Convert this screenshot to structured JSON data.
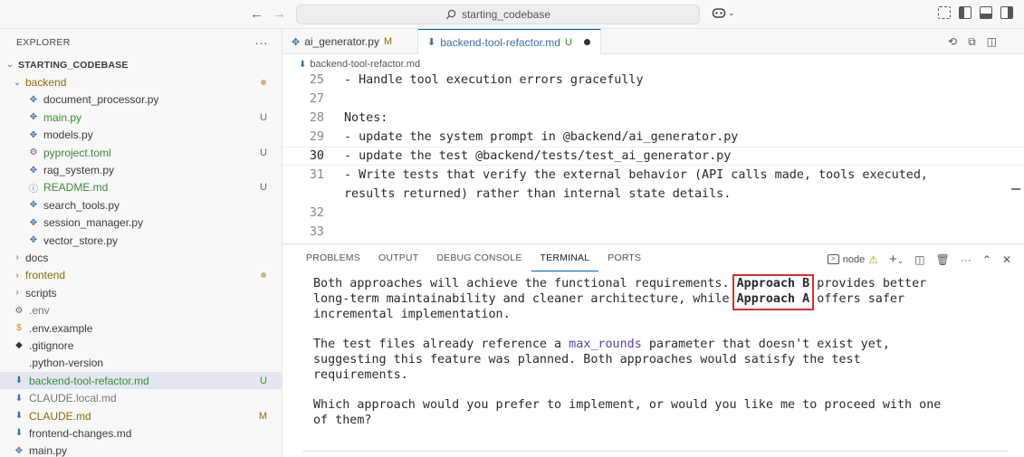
{
  "titlebar": {
    "search_text": "starting_codebase"
  },
  "sidebar": {
    "header": "EXPLORER",
    "root": "STARTING_CODEBASE",
    "items": [
      {
        "label": "backend",
        "kind": "folder-open",
        "depth": 1,
        "badge": "",
        "color": "c-mod",
        "dot": true
      },
      {
        "label": "document_processor.py",
        "kind": "py",
        "depth": 2,
        "badge": "",
        "color": ""
      },
      {
        "label": "main.py",
        "kind": "py",
        "depth": 2,
        "badge": "U",
        "color": "c-green"
      },
      {
        "label": "models.py",
        "kind": "py",
        "depth": 2,
        "badge": "",
        "color": ""
      },
      {
        "label": "pyproject.toml",
        "kind": "gear",
        "depth": 2,
        "badge": "U",
        "color": "c-green"
      },
      {
        "label": "rag_system.py",
        "kind": "py",
        "depth": 2,
        "badge": "",
        "color": ""
      },
      {
        "label": "README.md",
        "kind": "info",
        "depth": 2,
        "badge": "U",
        "color": "c-green"
      },
      {
        "label": "search_tools.py",
        "kind": "py",
        "depth": 2,
        "badge": "",
        "color": ""
      },
      {
        "label": "session_manager.py",
        "kind": "py",
        "depth": 2,
        "badge": "",
        "color": ""
      },
      {
        "label": "vector_store.py",
        "kind": "py",
        "depth": 2,
        "badge": "",
        "color": ""
      },
      {
        "label": "docs",
        "kind": "folder",
        "depth": 1,
        "badge": "",
        "color": ""
      },
      {
        "label": "frontend",
        "kind": "folder",
        "depth": 1,
        "badge": "",
        "color": "c-mod",
        "dot": true
      },
      {
        "label": "scripts",
        "kind": "folder",
        "depth": 1,
        "badge": "",
        "color": ""
      },
      {
        "label": ".env",
        "kind": "gear",
        "depth": 0,
        "badge": "",
        "color": "c-grey"
      },
      {
        "label": ".env.example",
        "kind": "dollar",
        "depth": 0,
        "badge": "",
        "color": ""
      },
      {
        "label": ".gitignore",
        "kind": "git",
        "depth": 0,
        "badge": "",
        "color": ""
      },
      {
        "label": ".python-version",
        "kind": "blank",
        "depth": 0,
        "badge": "",
        "color": ""
      },
      {
        "label": "backend-tool-refactor.md",
        "kind": "md",
        "depth": 0,
        "badge": "U",
        "color": "c-green",
        "selected": true
      },
      {
        "label": "CLAUDE.local.md",
        "kind": "md",
        "depth": 0,
        "badge": "",
        "color": "c-grey"
      },
      {
        "label": "CLAUDE.md",
        "kind": "md",
        "depth": 0,
        "badge": "M",
        "color": "c-mod"
      },
      {
        "label": "frontend-changes.md",
        "kind": "md",
        "depth": 0,
        "badge": "",
        "color": ""
      },
      {
        "label": "main.py",
        "kind": "py",
        "depth": 0,
        "badge": "",
        "color": ""
      }
    ]
  },
  "editor": {
    "tabs": [
      {
        "label": "ai_generator.py",
        "status": "M",
        "icon": "py"
      },
      {
        "label": "backend-tool-refactor.md",
        "status": "U",
        "icon": "md",
        "active": true,
        "unsaved": true
      }
    ],
    "breadcrumb": "backend-tool-refactor.md",
    "lines": [
      {
        "n": "25",
        "text": "- Handle tool execution errors gracefully"
      },
      {
        "n": "27",
        "text": ""
      },
      {
        "n": "28",
        "text": "Notes:"
      },
      {
        "n": "29",
        "text": "- update the system prompt in @backend/ai_generator.py"
      },
      {
        "n": "30",
        "text": "- update the test @backend/tests/test_ai_generator.py",
        "current": true
      },
      {
        "n": "31",
        "text": "- Write tests that verify the external behavior (API calls made, tools executed,"
      },
      {
        "n": "",
        "text": "results returned) rather than internal state details."
      },
      {
        "n": "32",
        "text": ""
      },
      {
        "n": "33",
        "text": ""
      }
    ]
  },
  "panel": {
    "tabs": [
      "PROBLEMS",
      "OUTPUT",
      "DEBUG CONSOLE",
      "TERMINAL",
      "PORTS"
    ],
    "active_tab": "TERMINAL",
    "terminal_name": "node",
    "p1": {
      "a": "Both approaches will achieve the functional requirements. ",
      "b": "Approach B",
      "c": " provides better",
      "d": "long-term maintainability and cleaner architecture, while ",
      "e": "Approach A",
      "f": " offers safer",
      "g": "incremental implementation."
    },
    "p2": {
      "a": "The test files already reference a ",
      "b": "max_rounds",
      "c": " parameter that doesn't exist yet,",
      "d": "suggesting this feature was planned. Both approaches would satisfy the test",
      "e": "requirements."
    },
    "p3": {
      "a": "Which approach would you prefer to implement, or would you like me to proceed with one",
      "b": "of them?"
    }
  },
  "colors": {
    "accent": "#005fb8",
    "highlight_box": "#d93030",
    "untracked": "#388a34",
    "modified": "#8a6d00"
  }
}
